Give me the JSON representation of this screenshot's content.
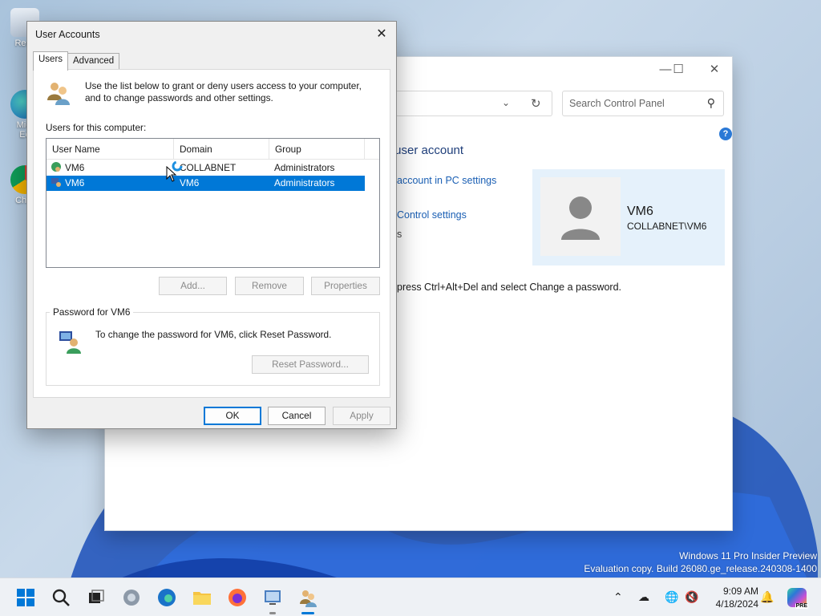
{
  "desktop": {
    "icons": [
      {
        "label": "Recy",
        "icon": "recycle-bin-icon"
      },
      {
        "label": "Micr\nEd",
        "icon": "edge-shortcut-icon"
      },
      {
        "label": "Chro",
        "icon": "chrome-shortcut-icon"
      }
    ],
    "watermark_line1": "Windows 11 Pro Insider Preview",
    "watermark_line2": "Evaluation copy. Build 26080.ge_release.240308-1400"
  },
  "control_panel": {
    "search_placeholder": "Search Control Panel",
    "heading": "r user account",
    "link1": "account in PC settings",
    "link2": "Control settings",
    "fragment": "s",
    "password_hint": "press Ctrl+Alt+Del and select Change a password.",
    "card_name": "VM6",
    "card_sub": "COLLABNET\\VM6"
  },
  "dialog": {
    "title": "User Accounts",
    "tabs": [
      "Users",
      "Advanced"
    ],
    "intro": "Use the list below to grant or deny users access to your computer, and to change passwords and other settings.",
    "users_label": "Users for this computer:",
    "columns": [
      "User Name",
      "Domain",
      "Group"
    ],
    "rows": [
      {
        "user": "VM6",
        "domain": "COLLABNET",
        "group": "Administrators",
        "selected": false
      },
      {
        "user": "VM6",
        "domain": "VM6",
        "group": "Administrators",
        "selected": true
      }
    ],
    "buttons": {
      "add": "Add...",
      "remove": "Remove",
      "properties": "Properties"
    },
    "password_group": {
      "legend": "Password for VM6",
      "text": "To change the password for VM6, click Reset Password.",
      "reset": "Reset Password..."
    },
    "footer": {
      "ok": "OK",
      "cancel": "Cancel",
      "apply": "Apply"
    }
  },
  "taskbar": {
    "time": "9:09 AM",
    "date": "4/18/2024",
    "copilot_badge": "PRE",
    "accent": "#0078d7"
  }
}
